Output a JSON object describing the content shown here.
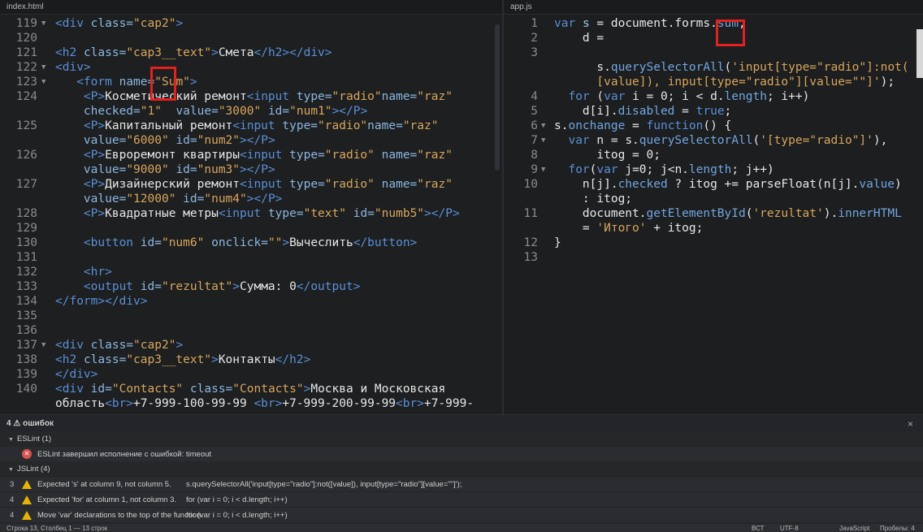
{
  "left": {
    "tab": "index.html",
    "lines": [
      {
        "n": "119",
        "fold": "▼",
        "html": "<span class=\"tg\">&lt;div</span> <span class=\"at\">class=</span><span class=\"st\">\"cap2\"</span><span class=\"tg\">&gt;</span>"
      },
      {
        "n": "120",
        "fold": "",
        "html": ""
      },
      {
        "n": "121",
        "fold": "",
        "html": "<span class=\"tg\">&lt;h2</span> <span class=\"at\">class=</span><span class=\"st\">\"cap3__text\"</span><span class=\"tg\">&gt;</span>Смета<span class=\"tg\">&lt;/h2&gt;&lt;/div&gt;</span>"
      },
      {
        "n": "122",
        "fold": "▼",
        "html": "<span class=\"tg\">&lt;div&gt;</span>"
      },
      {
        "n": "123",
        "fold": "▼",
        "html": "   <span class=\"tg\">&lt;form</span> <span class=\"at\">name=</span><span class=\"st\">\"Sum\"</span><span class=\"tg\">&gt;</span>"
      },
      {
        "n": "124",
        "fold": "",
        "html": "    <span class=\"tg\">&lt;P&gt;</span>Косметический ремонт<span class=\"tg\">&lt;input</span> <span class=\"at\">type=</span><span class=\"st\">\"radio\"</span><span class=\"at\">name=</span><span class=\"st\">\"raz\"</span>"
      },
      {
        "n": "",
        "fold": "",
        "html": "    <span class=\"at\">checked=</span><span class=\"st\">\"1\"</span>  <span class=\"at\">value=</span><span class=\"st\">\"3000\"</span> <span class=\"at\">id=</span><span class=\"st\">\"num1\"</span><span class=\"tg\">&gt;&lt;/P&gt;</span>"
      },
      {
        "n": "125",
        "fold": "",
        "html": "    <span class=\"tg\">&lt;P&gt;</span>Капитальный ремонт<span class=\"tg\">&lt;input</span> <span class=\"at\">type=</span><span class=\"st\">\"radio\"</span><span class=\"at\">name=</span><span class=\"st\">\"raz\"</span>"
      },
      {
        "n": "",
        "fold": "",
        "html": "    <span class=\"at\">value=</span><span class=\"st\">\"6000\"</span> <span class=\"at\">id=</span><span class=\"st\">\"num2\"</span><span class=\"tg\">&gt;&lt;/P&gt;</span>"
      },
      {
        "n": "126",
        "fold": "",
        "html": "    <span class=\"tg\">&lt;P&gt;</span>Евроремонт квартиры<span class=\"tg\">&lt;input</span> <span class=\"at\">type=</span><span class=\"st\">\"radio\"</span> <span class=\"at\">name=</span><span class=\"st\">\"raz\"</span>"
      },
      {
        "n": "",
        "fold": "",
        "html": "    <span class=\"at\">value=</span><span class=\"st\">\"9000\"</span> <span class=\"at\">id=</span><span class=\"st\">\"num3\"</span><span class=\"tg\">&gt;&lt;/P&gt;</span>"
      },
      {
        "n": "127",
        "fold": "",
        "html": "    <span class=\"tg\">&lt;P&gt;</span>Дизайнерский ремонт<span class=\"tg\">&lt;input</span> <span class=\"at\">type=</span><span class=\"st\">\"radio\"</span> <span class=\"at\">name=</span><span class=\"st\">\"raz\"</span>"
      },
      {
        "n": "",
        "fold": "",
        "html": "    <span class=\"at\">value=</span><span class=\"st\">\"12000\"</span> <span class=\"at\">id=</span><span class=\"st\">\"num4\"</span><span class=\"tg\">&gt;&lt;/P&gt;</span>"
      },
      {
        "n": "128",
        "fold": "",
        "html": "    <span class=\"tg\">&lt;P&gt;</span>Квадратные метры<span class=\"tg\">&lt;input</span> <span class=\"at\">type=</span><span class=\"st\">\"text\"</span> <span class=\"at\">id=</span><span class=\"st\">\"numb5\"</span><span class=\"tg\">&gt;&lt;/P&gt;</span>"
      },
      {
        "n": "129",
        "fold": "",
        "html": ""
      },
      {
        "n": "130",
        "fold": "",
        "html": "    <span class=\"tg\">&lt;button</span> <span class=\"at\">id=</span><span class=\"st\">\"num6\"</span> <span class=\"at\">onclick=</span><span class=\"st\">\"\"</span><span class=\"tg\">&gt;</span>Вычеслить<span class=\"tg\">&lt;/button&gt;</span>"
      },
      {
        "n": "131",
        "fold": "",
        "html": ""
      },
      {
        "n": "132",
        "fold": "",
        "html": "    <span class=\"tg\">&lt;hr&gt;</span>"
      },
      {
        "n": "133",
        "fold": "",
        "html": "    <span class=\"tg\">&lt;output</span> <span class=\"at\">id=</span><span class=\"st\">\"rezultat\"</span><span class=\"tg\">&gt;</span>Сумма: 0<span class=\"tg\">&lt;/output&gt;</span>"
      },
      {
        "n": "134",
        "fold": "",
        "html": "<span class=\"tg\">&lt;/form&gt;&lt;/div&gt;</span>"
      },
      {
        "n": "135",
        "fold": "",
        "html": ""
      },
      {
        "n": "136",
        "fold": "",
        "html": ""
      },
      {
        "n": "137",
        "fold": "▼",
        "html": "<span class=\"tg\">&lt;div</span> <span class=\"at\">class=</span><span class=\"st\">\"cap2\"</span><span class=\"tg\">&gt;</span>"
      },
      {
        "n": "138",
        "fold": "",
        "html": "<span class=\"tg\">&lt;h2</span> <span class=\"at\">class=</span><span class=\"st\">\"cap3__text\"</span><span class=\"tg\">&gt;</span>Контакты<span class=\"tg\">&lt;/h2&gt;</span>"
      },
      {
        "n": "139",
        "fold": "",
        "html": "<span class=\"tg\">&lt;/div&gt;</span>"
      },
      {
        "n": "140",
        "fold": "",
        "html": "<span class=\"tg\">&lt;div</span> <span class=\"at\">id=</span><span class=\"st\">\"Contacts\"</span> <span class=\"at\">class=</span><span class=\"st\">\"Contacts\"</span><span class=\"tg\">&gt;</span>Москва и Московская"
      },
      {
        "n": "",
        "fold": "",
        "html": "область<span class=\"tg\">&lt;br&gt;</span>+7-999-100-99-99 <span class=\"tg\">&lt;br&gt;</span>+7-999-200-99-99<span class=\"tg\">&lt;br&gt;</span>+7-999-"
      }
    ]
  },
  "right": {
    "tab": "app.js",
    "lines": [
      {
        "n": "1",
        "fold": "",
        "html": "<span class=\"kw\">var</span> <span class=\"ob\">s</span> = document.forms.<span class=\"pr\">sum</span>,"
      },
      {
        "n": "2",
        "fold": "",
        "html": "    d ="
      },
      {
        "n": "3",
        "fold": "",
        "html": ""
      },
      {
        "n": "",
        "fold": "",
        "html": "      s.<span class=\"pr\">querySelectorAll</span>(<span class=\"st\">'input[type=\"radio\"]:not(</span>"
      },
      {
        "n": "",
        "fold": "",
        "html": "      <span class=\"st\">[value]), input[type=\"radio\"][value=\"\"]'</span>);"
      },
      {
        "n": "4",
        "fold": "",
        "html": "  <span class=\"kw\">for</span> (<span class=\"kw\">var</span> i = 0; i &lt; d.<span class=\"pr\">length</span>; i++)"
      },
      {
        "n": "5",
        "fold": "",
        "html": "    d[i].<span class=\"pr\">disabled</span> = <span class=\"kw\">true</span>;"
      },
      {
        "n": "6",
        "fold": "▼",
        "html": "s.<span class=\"pr\">onchange</span> = <span class=\"kw\">function</span>() {"
      },
      {
        "n": "7",
        "fold": "▼",
        "html": "  <span class=\"kw\">var</span> n = s.<span class=\"pr\">querySelectorAll</span>(<span class=\"st\">'[type=\"radio\"]'</span>),"
      },
      {
        "n": "8",
        "fold": "",
        "html": "      itog = 0;"
      },
      {
        "n": "9",
        "fold": "▼",
        "html": "  <span class=\"kw\">for</span>(<span class=\"kw\">var</span> j=0; j&lt;n.<span class=\"pr\">length</span>; j++)"
      },
      {
        "n": "10",
        "fold": "",
        "html": "    n[j].<span class=\"pr\">checked</span> ? itog += parseFloat(n[j].<span class=\"pr\">value</span>)"
      },
      {
        "n": "",
        "fold": "",
        "html": "    : itog;"
      },
      {
        "n": "11",
        "fold": "",
        "html": "    document.<span class=\"pr\">getElementById</span>(<span class=\"st\">'rezultat'</span>).<span class=\"pr\">innerHTML</span>"
      },
      {
        "n": "",
        "fold": "",
        "html": "    = <span class=\"st\">'Итого'</span> + itog;"
      },
      {
        "n": "12",
        "fold": "",
        "html": "}"
      },
      {
        "n": "13",
        "fold": "",
        "html": ""
      }
    ]
  },
  "panel": {
    "title": "4 ⚠ ошибок",
    "close": "×",
    "eslint_header": "ESLint (1)",
    "eslint_error": "ESLint завершил исполнение с ошибкой: timeout",
    "jslint_header": "JSLint (4)",
    "rows": [
      {
        "num": "3",
        "msg": "Expected 's' at column 9, not column 5.",
        "src": "s.querySelectorAll('input[type=\"radio\"]:not([value]), input[type=\"radio\"][value=\"\"]');"
      },
      {
        "num": "4",
        "msg": "Expected 'for' at column 1, not column 3.",
        "src": "for (var i = 0; i < d.length; i++)"
      },
      {
        "num": "4",
        "msg": "Move 'var' declarations to the top of the function.",
        "src": "for (var i = 0; i < d.length; i++)"
      }
    ]
  },
  "status": {
    "position": "Строка 13, Столбец 1 — 13 строк",
    "ins": "ВСТ",
    "encoding": "UTF-8",
    "language": "JavaScript",
    "spaces": "Пробелы: 4"
  },
  "colors": {
    "tag": "#5a8fd6",
    "string": "#d9a55b",
    "highlight_box": "#e61f1f",
    "error_icon": "#d9534f",
    "warning_icon": "#e6b400"
  }
}
